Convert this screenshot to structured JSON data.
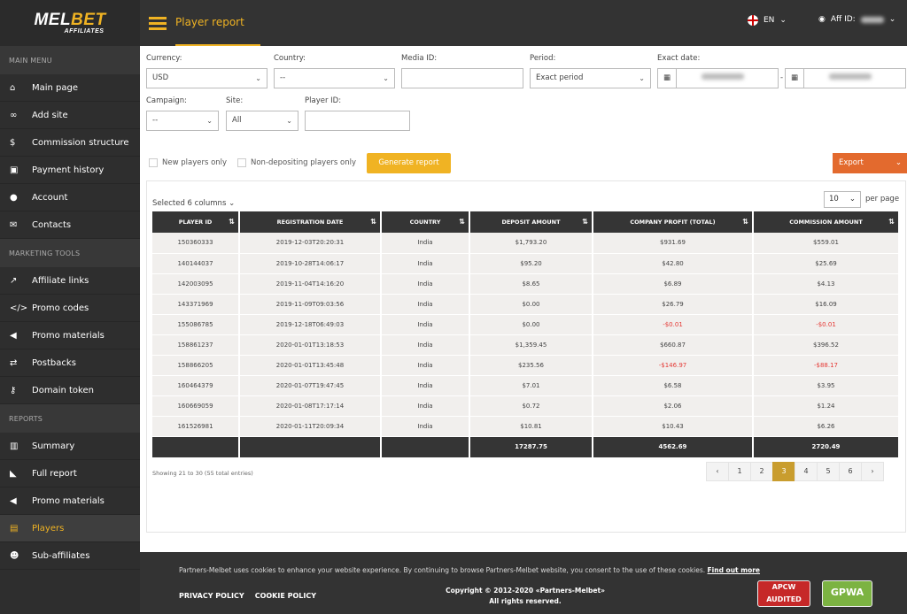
{
  "brand": {
    "logo_main_a": "MEL",
    "logo_main_b": "BET",
    "logo_sub": "AFFILIATES"
  },
  "sidebar": {
    "sections": [
      {
        "title": "MAIN MENU",
        "items": [
          {
            "label": "Main page",
            "icon": "home-icon"
          },
          {
            "label": "Add site",
            "icon": "link-icon"
          },
          {
            "label": "Commission structure",
            "icon": "dollar-icon"
          },
          {
            "label": "Payment history",
            "icon": "money-icon"
          },
          {
            "label": "Account",
            "icon": "user-icon"
          },
          {
            "label": "Contacts",
            "icon": "envelope-icon"
          }
        ]
      },
      {
        "title": "MARKETING TOOLS",
        "items": [
          {
            "label": "Affiliate links",
            "icon": "external-link-icon"
          },
          {
            "label": "Promo codes",
            "icon": "code-icon"
          },
          {
            "label": "Promo materials",
            "icon": "bullhorn-icon"
          },
          {
            "label": "Postbacks",
            "icon": "share-icon"
          },
          {
            "label": "Domain token",
            "icon": "key-icon"
          }
        ]
      },
      {
        "title": "REPORTS",
        "items": [
          {
            "label": "Summary",
            "icon": "bar-chart-icon"
          },
          {
            "label": "Full report",
            "icon": "area-chart-icon"
          },
          {
            "label": "Promo materials",
            "icon": "bullhorn-icon"
          },
          {
            "label": "Players",
            "icon": "id-card-icon",
            "active": true
          },
          {
            "label": "Sub-affiliates",
            "icon": "users-icon"
          }
        ]
      }
    ]
  },
  "header": {
    "title": "Player report",
    "lang": "EN",
    "aff_label": "Aff ID:"
  },
  "filters": {
    "currency": {
      "label": "Currency:",
      "value": "USD"
    },
    "country": {
      "label": "Country:",
      "value": "--"
    },
    "media_id": {
      "label": "Media ID:",
      "value": ""
    },
    "period": {
      "label": "Period:",
      "value": "Exact period"
    },
    "exact_date": {
      "label": "Exact date:",
      "separator": "-"
    },
    "campaign": {
      "label": "Campaign:",
      "value": "--"
    },
    "site": {
      "label": "Site:",
      "value": "All"
    },
    "player_id": {
      "label": "Player ID:",
      "value": ""
    }
  },
  "options": {
    "new_players": "New players only",
    "non_depositing": "Non-depositing players only"
  },
  "buttons": {
    "generate": "Generate report",
    "export": "Export"
  },
  "columns_selector": "Selected 6 columns",
  "per_page": {
    "value": "10",
    "label": "per page"
  },
  "table": {
    "headers": [
      "PLAYER ID",
      "REGISTRATION DATE",
      "COUNTRY",
      "DEPOSIT AMOUNT",
      "COMPANY PROFIT (TOTAL)",
      "COMMISSION AMOUNT"
    ],
    "rows": [
      [
        "150360333",
        "2019-12-03T20:20:31",
        "India",
        "$1,793.20",
        "$931.69",
        "$559.01"
      ],
      [
        "140144037",
        "2019-10-28T14:06:17",
        "India",
        "$95.20",
        "$42.80",
        "$25.69"
      ],
      [
        "142003095",
        "2019-11-04T14:16:20",
        "India",
        "$8.65",
        "$6.89",
        "$4.13"
      ],
      [
        "143371969",
        "2019-11-09T09:03:56",
        "India",
        "$0.00",
        "$26.79",
        "$16.09"
      ],
      [
        "155086785",
        "2019-12-18T06:49:03",
        "India",
        "$0.00",
        "-$0.01",
        "-$0.01"
      ],
      [
        "158861237",
        "2020-01-01T13:18:53",
        "India",
        "$1,359.45",
        "$660.87",
        "$396.52"
      ],
      [
        "158866205",
        "2020-01-01T13:45:48",
        "India",
        "$235.56",
        "-$146.97",
        "-$88.17"
      ],
      [
        "160464379",
        "2020-01-07T19:47:45",
        "India",
        "$7.01",
        "$6.58",
        "$3.95"
      ],
      [
        "160669059",
        "2020-01-08T17:17:14",
        "India",
        "$0.72",
        "$2.06",
        "$1.24"
      ],
      [
        "161526981",
        "2020-01-11T20:09:34",
        "India",
        "$10.81",
        "$10.43",
        "$6.26"
      ]
    ],
    "totals": [
      "",
      "",
      "",
      "17287.75",
      "4562.69",
      "2720.49"
    ]
  },
  "showing": "Showing 21 to 30 (55 total entries)",
  "pagination": {
    "prev": "‹",
    "pages": [
      "1",
      "2",
      "3",
      "4",
      "5",
      "6"
    ],
    "current": "3",
    "next": "›"
  },
  "footer": {
    "cookie_text": "Partners-Melbet uses cookies to enhance your website experience. By continuing to browse Partners-Melbet website, you consent to the use of these cookies.",
    "find_out_more": "Find out more",
    "privacy": "PRIVACY POLICY",
    "cookie_policy": "COOKIE POLICY",
    "copyright": "Copyright © 2012-2020 «Partners-Melbet»",
    "rights": "All rights reserved.",
    "badge_apcw": "APCW AUDITED",
    "badge_gpwa": "GPWA"
  }
}
